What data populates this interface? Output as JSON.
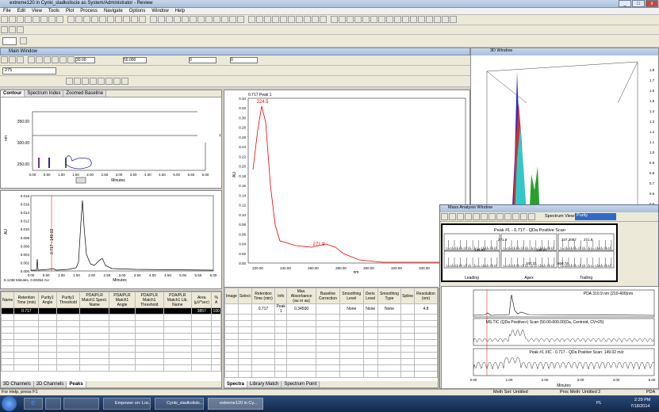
{
  "app_title": "extreme120 in Cynki_sladkoliscie as System/Administrator - Review",
  "menu": [
    "File",
    "Edit",
    "View",
    "Tools",
    "Plot",
    "Process",
    "Navigate",
    "Options",
    "Window",
    "Help"
  ],
  "main_window_title": "Main Window",
  "inputs": {
    "wl_start": "30.00",
    "wl_end": "50.000",
    "min_val": "0",
    "max_val": "0",
    "channel": "275"
  },
  "contour": {
    "tabs": [
      "Contour",
      "Spectrum Index",
      "Zoomed Baseline"
    ],
    "yaxis_label": "nm",
    "wavelength_label": "310.9",
    "yticks": [
      "350.00",
      "300.00",
      "250.00"
    ],
    "xticks": [
      "0.00",
      "0.50",
      "1.00",
      "1.50",
      "2.00",
      "2.50",
      "3.00",
      "3.50",
      "4.00",
      "4.50",
      "5.00",
      "5.50",
      "6.00"
    ],
    "xlabel": "Minutes"
  },
  "chromatogram": {
    "ylabel": "AU",
    "yticks": [
      "0.018",
      "0.016",
      "0.014",
      "0.012",
      "0.010",
      "0.008",
      "0.006",
      "0.004",
      "0.002",
      "0.000"
    ],
    "xticks": [
      "0.00",
      "0.50",
      "1.00",
      "1.50",
      "2.00",
      "2.50",
      "3.00",
      "3.50",
      "4.00",
      "4.50",
      "5.00",
      "5.50",
      "6.00"
    ],
    "xlabel": "Minutes",
    "peak_label": "0.717 - 149.02",
    "cursor_readout": "5.1238 Minutes, 0.00354 AU"
  },
  "spectrum": {
    "title": "0.717 Peak 1",
    "ylabel": "AU",
    "xlabel": "nm",
    "peak1": "224.5",
    "peak2": "271.9",
    "yticks": [
      "0.34",
      "0.32",
      "0.30",
      "0.28",
      "0.26",
      "0.24",
      "0.22",
      "0.20",
      "0.18",
      "0.16",
      "0.14",
      "0.12",
      "0.10",
      "0.08",
      "0.06",
      "0.04",
      "0.02",
      "0.00"
    ],
    "xticks": [
      "220.00",
      "240.00",
      "260.00",
      "280.00",
      "300.00",
      "320.00",
      "340.00",
      "360.00"
    ]
  },
  "peak_table": {
    "headers": [
      "Name",
      "Retention Time (min)",
      "Purity1 Angle",
      "Purity1 Threshold",
      "PDA/PLR Match1 Spect. Name",
      "PDA/PLR Match1 Angle",
      "PDA/PLR Match1 Threshold",
      "PDA/PLR Match1 Lib. Name",
      "Area (µV*sec)",
      "% A"
    ],
    "row": [
      "",
      "0.717",
      "",
      "",
      "",
      "",
      "",
      "",
      "3857",
      "100"
    ],
    "tabs": [
      "3D Channels",
      "2D Channels",
      "Peaks"
    ]
  },
  "spectra_table": {
    "headers": [
      "Image",
      "Select",
      "Retention Time (min)",
      "Info",
      "Max. Absorbance (au or au)",
      "Baseline Correction",
      "Smoothing Level",
      "Deriv. Level",
      "Smoothing Type",
      "Spline",
      "Resolution (nm)"
    ],
    "row": [
      "",
      "",
      "0.717",
      "Peak 1",
      "0.34500",
      "",
      "None",
      "None",
      "None",
      "",
      "4.8"
    ],
    "tabs": [
      "Spectra",
      "Library Match",
      "Spectrum Point"
    ]
  },
  "mass_window": {
    "title": "Mass Analysis Window",
    "spectrum_view_label": "Spectrum View:",
    "spectrum_view_value": "Purity",
    "scan_title": "Peak #1 - 0.717 - QDa Positive Scan",
    "cells": [
      "Leading",
      "Apex",
      "Trailing"
    ],
    "labels": [
      "271.9",
      "347.3087",
      "271.9",
      "149.02",
      "347.31",
      "569.74",
      "149.27"
    ],
    "pda_title": "PDA 310.9 nm (210-400)nm",
    "tic_title": "MS TIC (QDa Positive+) Scan (50.00-600.00)Da, Centroid, CV=25)",
    "xic_title": "Peak #1 XIC - 0.717 - QDa Positive Scan: 149.02 m/z",
    "xlabel": "Minutes",
    "xticks": [
      "0.00",
      "1.00",
      "2.00",
      "3.00",
      "4.00",
      "5.00"
    ]
  },
  "plot3d_title": "3D Window",
  "plot3d_yticks": [
    "1.8",
    "1.7",
    "1.6",
    "1.5",
    "1.4",
    "1.3",
    "1.2",
    "1.1",
    "1.0",
    "0.9",
    "0.8",
    "0.7",
    "0.6",
    "0.5",
    "0.4",
    "0.3",
    "0.2"
  ],
  "status": {
    "left": "For Help, press F1",
    "meth_set": "Meth Set: Untitled",
    "proc_meth": "Proc Meth: Untitled 2",
    "pda": "PDA"
  },
  "taskbar": {
    "items": [
      "Empower on: Loc...",
      "Cynki_sladkolistc...",
      "extreme120 in Cy..."
    ],
    "lang": "PL",
    "time": "2:29 PM",
    "date": "7/18/2014"
  }
}
